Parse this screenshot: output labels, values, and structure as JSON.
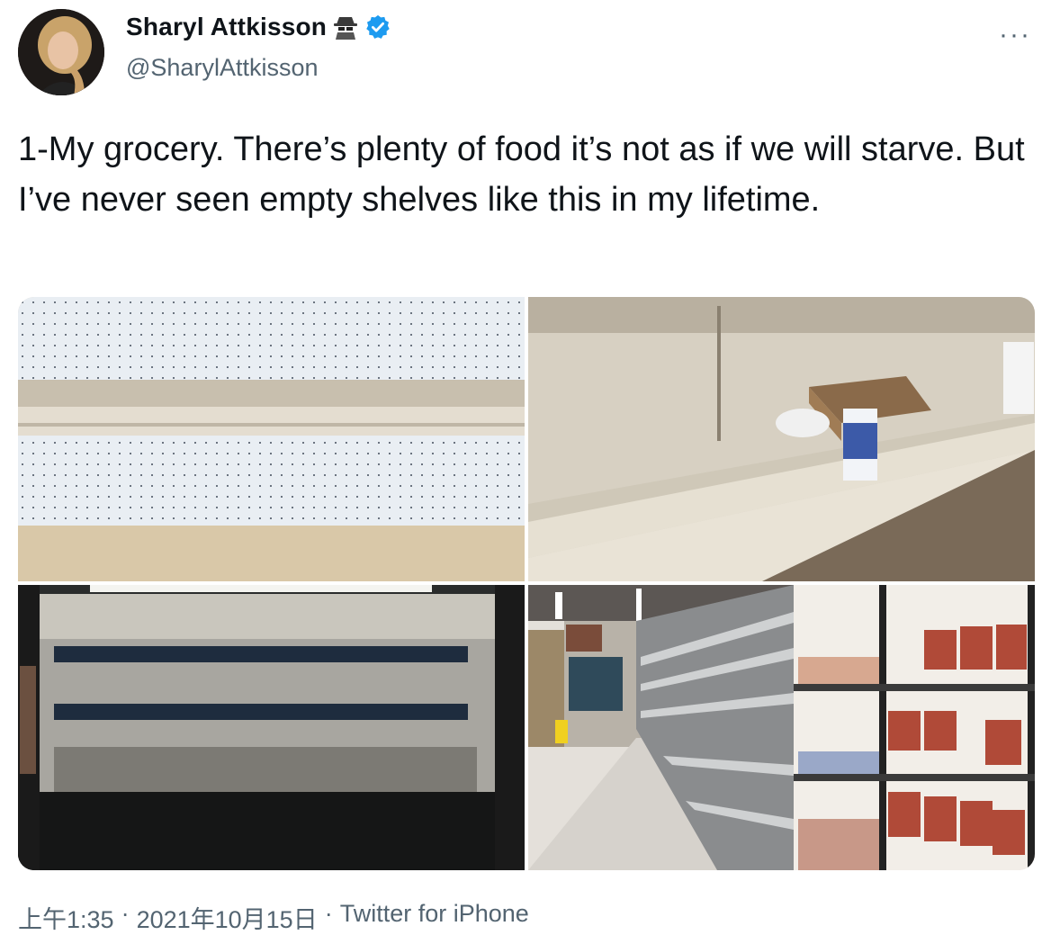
{
  "author": {
    "name": "Sharyl Attkisson",
    "handle": "@SharylAttkisson",
    "name_emoji": "🕵",
    "verified_icon": "verified-badge-icon"
  },
  "tweet": {
    "text": "1-My grocery. There’s plenty of food it’s not as if we will starve. But I’ve never seen empty shelves like this in my lifetime."
  },
  "menu": {
    "more_label": "···"
  },
  "meta": {
    "time": "上午1:35",
    "sep1": "·",
    "date": "2021年10月15日",
    "sep2": "·",
    "source": "Twitter for iPhone"
  },
  "colors": {
    "verified": "#1d9bf0",
    "text": "#0f1419",
    "secondary": "#536471"
  }
}
